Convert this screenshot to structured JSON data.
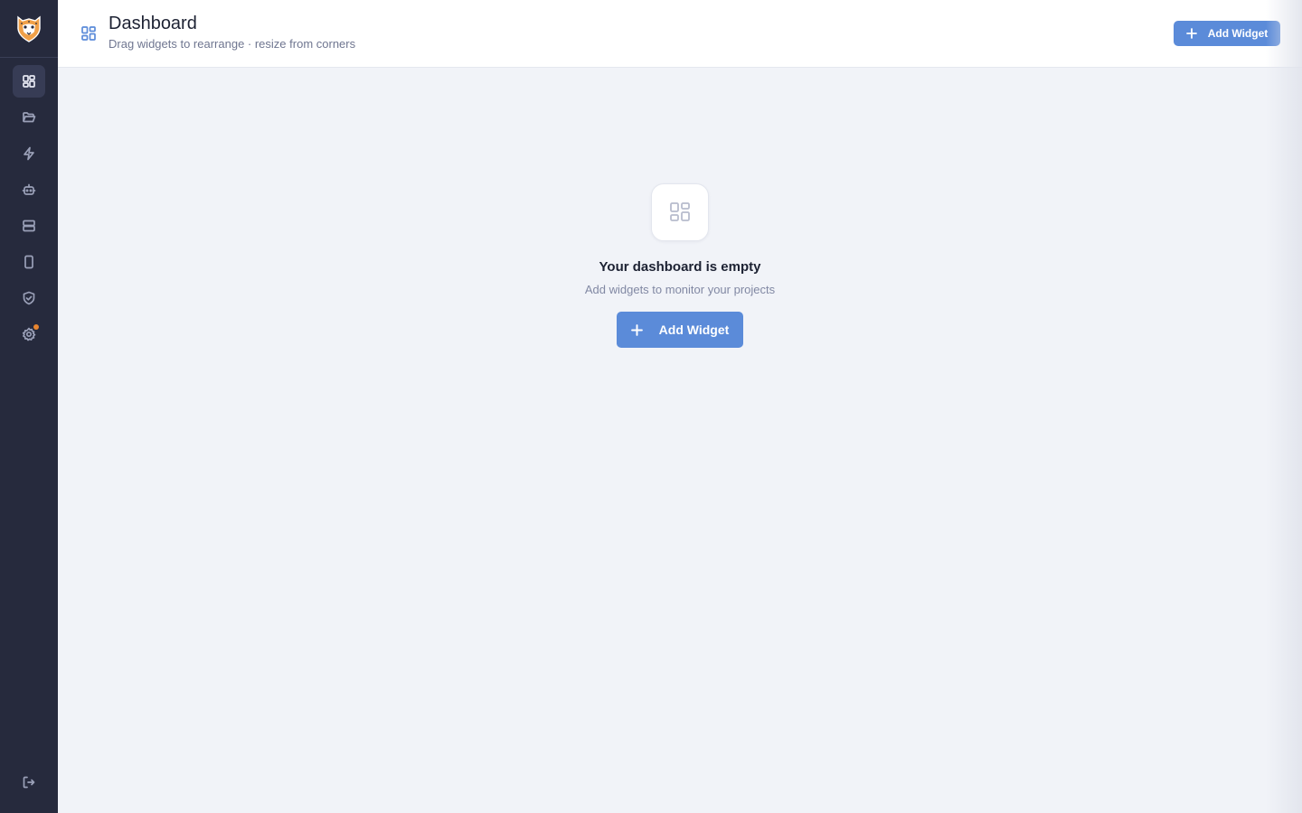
{
  "app": {
    "logo_icon": "cheetah-logo-icon",
    "accent_color": "#5b8bd9",
    "sidebar_bg": "#262a3d",
    "notification_color": "#e8852f"
  },
  "sidebar": {
    "items": [
      {
        "icon": "dashboard-grid-icon",
        "active": true
      },
      {
        "icon": "folder-open-icon",
        "active": false
      },
      {
        "icon": "lightning-icon",
        "active": false
      },
      {
        "icon": "robot-icon",
        "active": false
      },
      {
        "icon": "server-icon",
        "active": false
      },
      {
        "icon": "mobile-device-icon",
        "active": false
      },
      {
        "icon": "shield-check-icon",
        "active": false
      },
      {
        "icon": "gear-icon",
        "active": false,
        "badge": true
      }
    ],
    "logout_icon": "logout-icon"
  },
  "header": {
    "title": "Dashboard",
    "subtitle": "Drag widgets to rearrange · resize from corners",
    "add_button_label": "Add Widget"
  },
  "empty_state": {
    "title": "Your dashboard is empty",
    "subtitle": "Add widgets to monitor your projects",
    "button_label": "Add Widget"
  }
}
